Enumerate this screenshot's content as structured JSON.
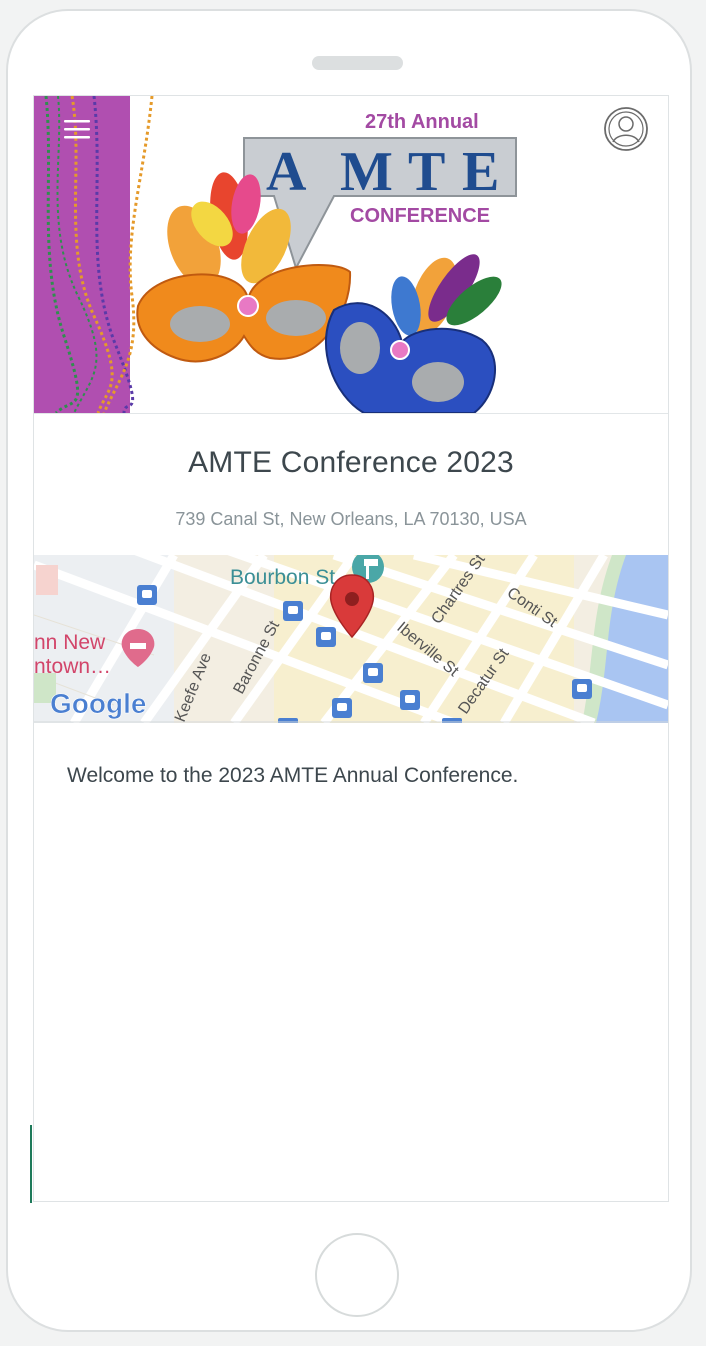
{
  "event": {
    "title": "AMTE Conference 2023",
    "address": "739 Canal St, New Orleans, LA 70130, USA",
    "welcome": "Welcome to the 2023 AMTE Annual Conference."
  },
  "banner": {
    "subtitle_top": "27th Annual",
    "logo_letters": [
      "A",
      "M",
      "T",
      "E"
    ],
    "subtitle_bottom": "CONFERENCE"
  },
  "map": {
    "labels": {
      "poi": "Bourbon St",
      "chartres": "Chartres St",
      "conti": "Conti St",
      "iberville": "Iberville St",
      "baronne": "Baronne St",
      "okeefe": "Keefe Ave",
      "decatur": "Decatur St",
      "hotel_line1": "nn New",
      "hotel_line2": "ntown…"
    },
    "attribution": "Google"
  },
  "colors": {
    "accent_purple": "#b04fb0",
    "title_text": "#3d474d",
    "muted_text": "#8a9499",
    "map_pin": "#d93a3a",
    "transit_blue": "#4a7fd1"
  },
  "icons": [
    "menu-icon",
    "user-avatar-icon",
    "map-pin-icon",
    "transit-icon",
    "hotel-icon"
  ]
}
